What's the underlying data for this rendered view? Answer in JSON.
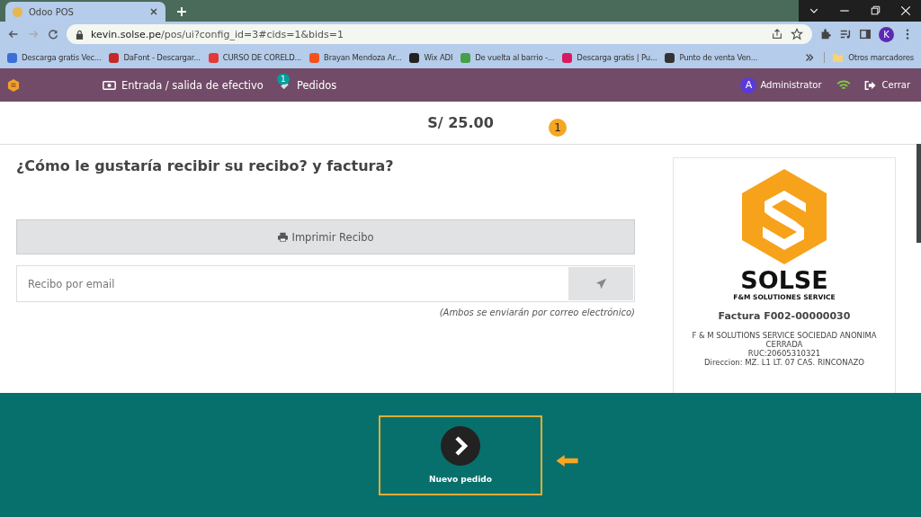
{
  "browser": {
    "tab_title": "Odoo POS",
    "url_host": "kevin.solse.pe",
    "url_path": "/pos/ui?config_id=3#cids=1&bids=1",
    "profile_initial": "K",
    "bookmarks": [
      {
        "label": "Descarga gratis Vec...",
        "color": "#3b6fd8"
      },
      {
        "label": "DaFont - Descargar...",
        "color": "#c62828"
      },
      {
        "label": "CURSO DE CORELD...",
        "color": "#e53935"
      },
      {
        "label": "Brayan Mendoza Ar...",
        "color": "#f4511e"
      },
      {
        "label": "Wix ADI",
        "color": "#222222"
      },
      {
        "label": "De vuelta al barrio -...",
        "color": "#43a047"
      },
      {
        "label": "Descarga gratis | Pu...",
        "color": "#d81b60"
      },
      {
        "label": "Punto de venta Ven...",
        "color": "#333333"
      }
    ],
    "other_bookmarks": "Otros marcadores"
  },
  "navbar": {
    "cash_button": "Entrada / salida de efectivo",
    "orders_badge": "1",
    "orders_button": "Pedidos",
    "user_initial": "A",
    "user_name": "Administrator",
    "close_button": "Cerrar"
  },
  "amount": "S/ 25.00",
  "step_marker": "1",
  "question": "¿Cómo le gustaría recibir su recibo? y factura?",
  "print_button": "Imprimir Recibo",
  "email": {
    "placeholder": "Recibo por email"
  },
  "note": "(Ambos se enviarán por correo electrónico)",
  "receipt": {
    "brand": "SOLSE",
    "brand_subtitle": "F&M SOLUTIONES SERVICE",
    "invoice": "Factura F002-00000030",
    "lines": [
      "F & M SOLUTIONS SERVICE SOCIEDAD ANONIMA",
      "CERRADA",
      "RUC:20605310321",
      "Direccion: MZ. L1 LT. 07 CAS. RINCONAZO"
    ]
  },
  "next_button": "Nuevo pedido"
}
